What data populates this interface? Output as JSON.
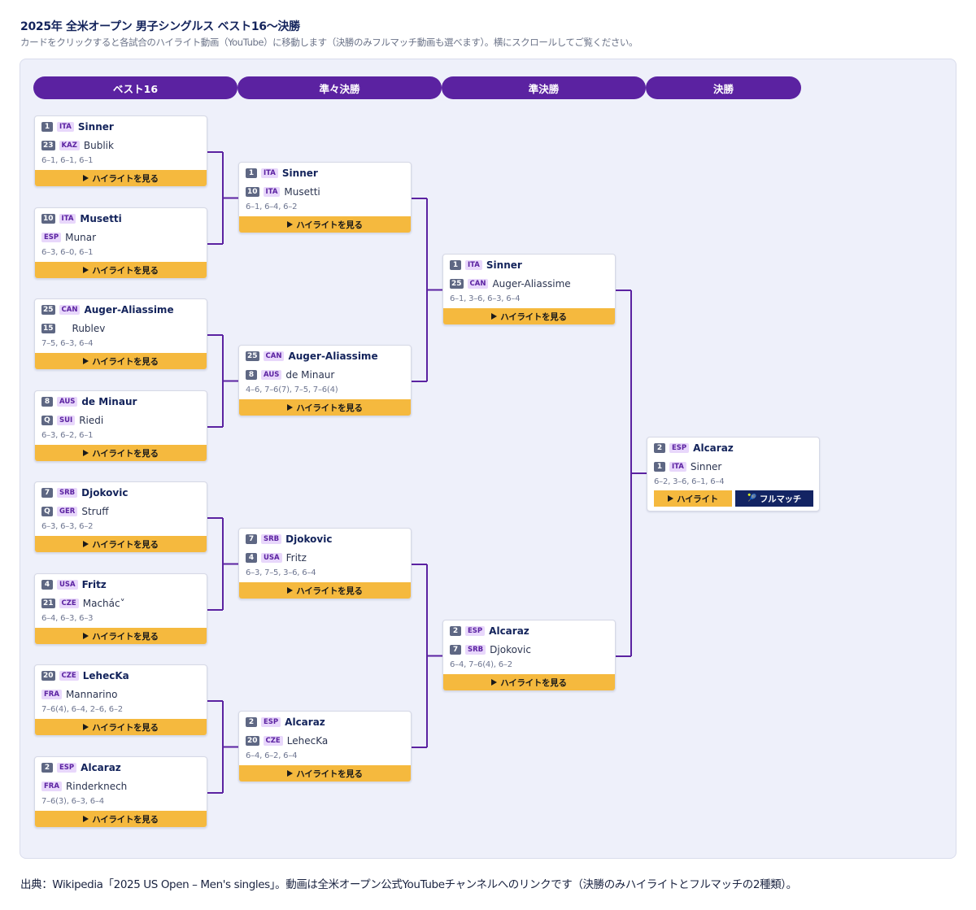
{
  "page": {
    "title": "2025年 全米オープン 男子シングルス ベスト16〜決勝",
    "subtitle": "カードをクリックすると各試合のハイライト動画（YouTube）に移動します（決勝のみフルマッチ動画も選べます）。横にスクロールしてご覧ください。",
    "footer": "出典：Wikipedia「2025 US Open – Men's singles」。動画は全米オープン公式YouTubeチャンネルへのリンクです（決勝のみハイライトとフルマッチの2種類）。"
  },
  "rounds": [
    "ベスト16",
    "準々決勝",
    "準決勝",
    "決勝"
  ],
  "buttons": {
    "highlight": "ハイライトを見る",
    "final_highlight": "ハイライト",
    "final_full": "フルマッチ"
  },
  "icons": {
    "play": "play-icon",
    "tennis": "tennis-ball-icon"
  },
  "colors": {
    "accent": "#5b22a1",
    "highlight_button": "#f5b93e",
    "full_match_button": "#132463",
    "seed_badge": "#5e6783",
    "nation_badge": "#e8d7fb"
  },
  "matches": {
    "r16": [
      {
        "winner": {
          "seed": "1",
          "nat": "ITA",
          "name": "Sinner"
        },
        "loser": {
          "seed": "23",
          "nat": "KAZ",
          "name": "Bublik"
        },
        "score": "6–1, 6–1, 6–1"
      },
      {
        "winner": {
          "seed": "10",
          "nat": "ITA",
          "name": "Musetti"
        },
        "loser": {
          "seed": "",
          "nat": "ESP",
          "name": "Munar"
        },
        "score": "6–3, 6–0, 6–1"
      },
      {
        "winner": {
          "seed": "25",
          "nat": "CAN",
          "name": "Auger-Aliassime"
        },
        "loser": {
          "seed": "15",
          "nat": "",
          "name": "Rublev"
        },
        "score": "7–5, 6–3, 6–4"
      },
      {
        "winner": {
          "seed": "8",
          "nat": "AUS",
          "name": "de Minaur"
        },
        "loser": {
          "seed": "Q",
          "nat": "SUI",
          "name": "Riedi"
        },
        "score": "6–3, 6–2, 6–1"
      },
      {
        "winner": {
          "seed": "7",
          "nat": "SRB",
          "name": "Djokovic"
        },
        "loser": {
          "seed": "Q",
          "nat": "GER",
          "name": "Struff"
        },
        "score": "6–3, 6–3, 6–2"
      },
      {
        "winner": {
          "seed": "4",
          "nat": "USA",
          "name": "Fritz"
        },
        "loser": {
          "seed": "21",
          "nat": "CZE",
          "name": "Machác˅"
        },
        "score": "6–4, 6–3, 6–3"
      },
      {
        "winner": {
          "seed": "20",
          "nat": "CZE",
          "name": "LehecKa"
        },
        "loser": {
          "seed": "",
          "nat": "FRA",
          "name": "Mannarino"
        },
        "score": "7–6(4), 6–4, 2–6, 6–2"
      },
      {
        "winner": {
          "seed": "2",
          "nat": "ESP",
          "name": "Alcaraz"
        },
        "loser": {
          "seed": "",
          "nat": "FRA",
          "name": "Rinderknech"
        },
        "score": "7–6(3), 6–3, 6–4"
      }
    ],
    "qf": [
      {
        "winner": {
          "seed": "1",
          "nat": "ITA",
          "name": "Sinner"
        },
        "loser": {
          "seed": "10",
          "nat": "ITA",
          "name": "Musetti"
        },
        "score": "6–1, 6–4, 6–2"
      },
      {
        "winner": {
          "seed": "25",
          "nat": "CAN",
          "name": "Auger-Aliassime"
        },
        "loser": {
          "seed": "8",
          "nat": "AUS",
          "name": "de Minaur"
        },
        "score": "4–6, 7–6(7), 7–5, 7–6(4)"
      },
      {
        "winner": {
          "seed": "7",
          "nat": "SRB",
          "name": "Djokovic"
        },
        "loser": {
          "seed": "4",
          "nat": "USA",
          "name": "Fritz"
        },
        "score": "6–3, 7–5, 3–6, 6–4"
      },
      {
        "winner": {
          "seed": "2",
          "nat": "ESP",
          "name": "Alcaraz"
        },
        "loser": {
          "seed": "20",
          "nat": "CZE",
          "name": "LehecKa"
        },
        "score": "6–4, 6–2, 6–4"
      }
    ],
    "sf": [
      {
        "winner": {
          "seed": "1",
          "nat": "ITA",
          "name": "Sinner"
        },
        "loser": {
          "seed": "25",
          "nat": "CAN",
          "name": "Auger-Aliassime"
        },
        "score": "6–1, 3–6, 6–3, 6–4"
      },
      {
        "winner": {
          "seed": "2",
          "nat": "ESP",
          "name": "Alcaraz"
        },
        "loser": {
          "seed": "7",
          "nat": "SRB",
          "name": "Djokovic"
        },
        "score": "6–4, 7–6(4), 6–2"
      }
    ],
    "final": [
      {
        "winner": {
          "seed": "2",
          "nat": "ESP",
          "name": "Alcaraz"
        },
        "loser": {
          "seed": "1",
          "nat": "ITA",
          "name": "Sinner"
        },
        "score": "6–2, 3–6, 6–1, 6–4"
      }
    ]
  }
}
